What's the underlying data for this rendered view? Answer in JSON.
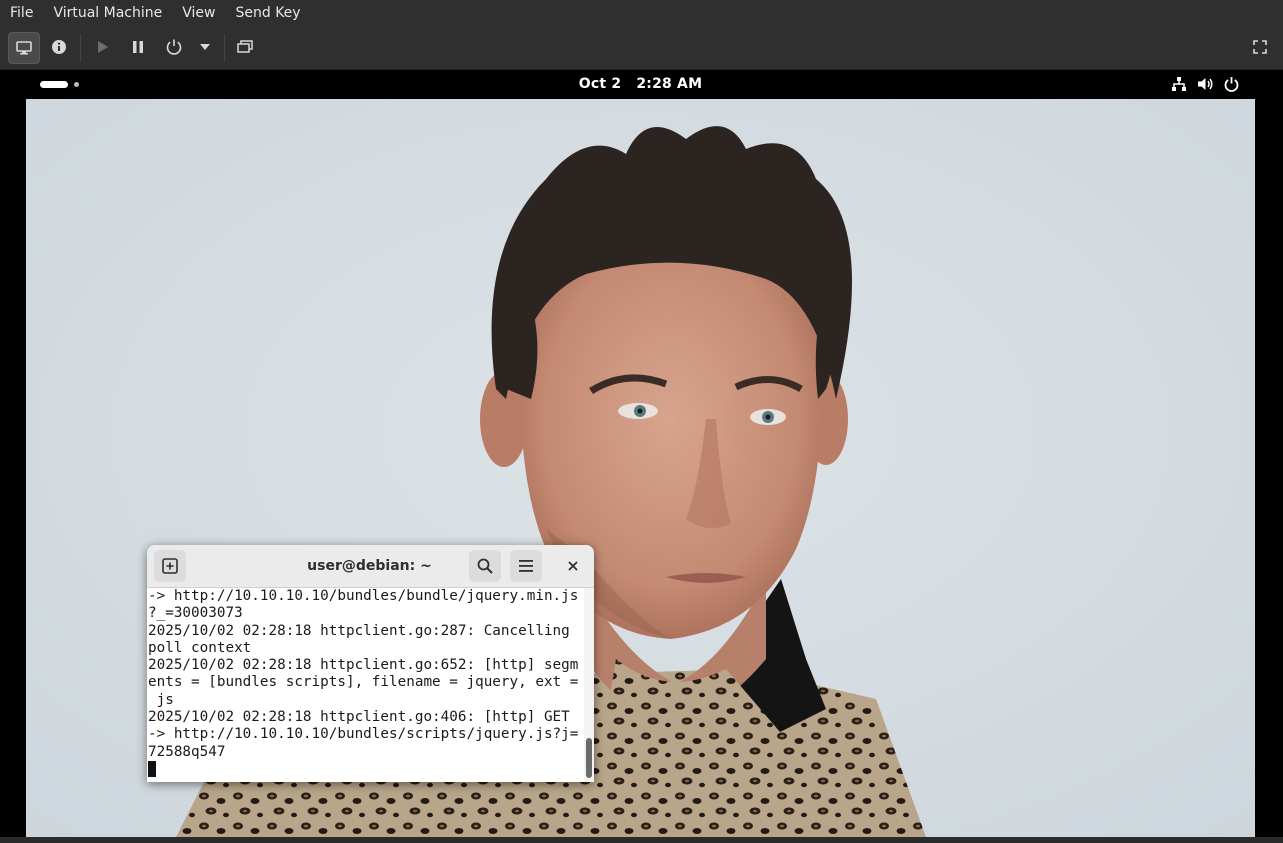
{
  "menubar": {
    "items": [
      {
        "label": "File"
      },
      {
        "label": "Virtual Machine"
      },
      {
        "label": "View"
      },
      {
        "label": "Send Key"
      }
    ]
  },
  "toolbar": {
    "buttons": [
      {
        "icon": "monitor-icon",
        "state": "active"
      },
      {
        "icon": "info-icon"
      },
      {
        "icon": "play-icon",
        "state": "disabled"
      },
      {
        "icon": "pause-icon"
      },
      {
        "icon": "power-icon"
      },
      {
        "icon": "chevron-down-icon"
      },
      {
        "icon": "screenshot-icon"
      },
      {
        "icon": "fullscreen-icon"
      }
    ]
  },
  "guest": {
    "topbar": {
      "date": "Oct 2",
      "time": "2:28 AM",
      "status_icons": [
        "network-icon",
        "volume-icon",
        "power-icon"
      ]
    },
    "wallpaper": {
      "subject": "portrait photo on light blue-grey background",
      "background_color": "#d4dbe0"
    },
    "terminal": {
      "title": "user@debian: ~",
      "lines": [
        "-> http://10.10.10.10/bundles/bundle/jquery.min.js",
        "?_=30003073",
        "2025/10/02 02:28:18 httpclient.go:287: Cancelling",
        "poll context",
        "2025/10/02 02:28:18 httpclient.go:652: [http] segm",
        "ents = [bundles scripts], filename = jquery, ext =",
        " js",
        "2025/10/02 02:28:18 httpclient.go:406: [http] GET",
        "-> http://10.10.10.10/bundles/scripts/jquery.js?j=",
        "72588q547"
      ]
    }
  }
}
